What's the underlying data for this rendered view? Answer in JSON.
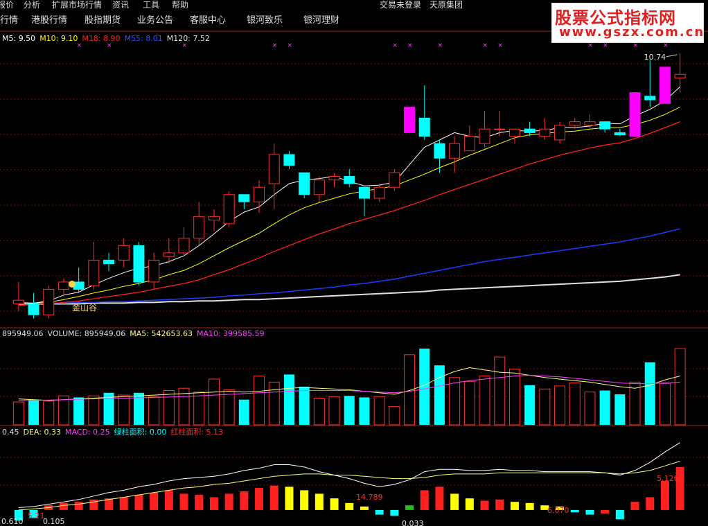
{
  "menu": {
    "items": [
      "报价",
      "分析",
      "扩展市场行情",
      "资讯",
      "工具",
      "帮助"
    ],
    "login_status": "交易未登录",
    "broker": "天原集团"
  },
  "tabs": [
    "行情",
    "港股行情",
    "股指期货",
    "业务公告",
    "客服中心",
    "银河致乐",
    "银河理财"
  ],
  "brand": {
    "title": "股票公式指标网",
    "url": "www.gszx.com.cn"
  },
  "colors": {
    "rise": "#ff3030",
    "fall": "#00ffff",
    "limit_up": "#ff00ff",
    "ma5": "#ffffff",
    "ma10": "#ffff00",
    "ma18": "#ff2020",
    "ma55": "#1e3cff",
    "ma120": "#e0e0e0",
    "vol_ma5": "#ffff80",
    "vol_ma10": "#ff40ff",
    "macd_pos": "#ff2020",
    "macd_neg": "#00ffff",
    "macd_yellow": "#ffff00",
    "macd_green": "#20c020"
  },
  "price_panel": {
    "legend": {
      "ma5": "M5: 9.50",
      "ma10": "M10: 9.10",
      "ma18": "M18: 8.90",
      "ma55": "M55: 8.01",
      "ma120": "M120: 7.52"
    },
    "high_label": "10.74",
    "annotation": "金山谷"
  },
  "volume_panel": {
    "legend": {
      "prefix": "895949.06",
      "volume": "VOLUME: 895949.06",
      "ma5": "MA5: 542653.63",
      "ma10": "MA10: 399585.59"
    }
  },
  "macd_panel": {
    "legend": {
      "prefix": "0.45",
      "dea": "DEA: 0.33",
      "macd": "MACD: 0.25",
      "green_area": "绿柱面积: 0.00",
      "red_area": "红柱面积: 5.13"
    },
    "labels": [
      "14.789",
      "6.070",
      "5.126",
      "0.610",
      "5.21",
      "0.105",
      "0.033"
    ]
  },
  "chart_data": {
    "type": "candlestick",
    "candles": [
      {
        "o": 7.3,
        "h": 7.6,
        "l": 7.2,
        "c": 7.35,
        "cls": "up"
      },
      {
        "o": 7.3,
        "h": 7.45,
        "l": 7.1,
        "c": 7.15,
        "cls": "down"
      },
      {
        "o": 7.15,
        "h": 7.55,
        "l": 7.1,
        "c": 7.5,
        "cls": "up"
      },
      {
        "o": 7.5,
        "h": 7.65,
        "l": 7.4,
        "c": 7.6,
        "cls": "up"
      },
      {
        "o": 7.6,
        "h": 7.8,
        "l": 7.45,
        "c": 7.5,
        "cls": "down"
      },
      {
        "o": 7.55,
        "h": 8.15,
        "l": 7.5,
        "c": 7.9,
        "cls": "up"
      },
      {
        "o": 7.85,
        "h": 8.0,
        "l": 7.75,
        "c": 7.9,
        "cls": "down"
      },
      {
        "o": 7.9,
        "h": 8.2,
        "l": 7.8,
        "c": 8.1,
        "cls": "up"
      },
      {
        "o": 8.1,
        "h": 8.15,
        "l": 7.55,
        "c": 7.6,
        "cls": "down"
      },
      {
        "o": 7.6,
        "h": 8.0,
        "l": 7.5,
        "c": 7.9,
        "cls": "up"
      },
      {
        "o": 7.95,
        "h": 8.2,
        "l": 7.85,
        "c": 8.0,
        "cls": "up"
      },
      {
        "o": 8.0,
        "h": 8.35,
        "l": 7.95,
        "c": 8.2,
        "cls": "up"
      },
      {
        "o": 8.2,
        "h": 8.7,
        "l": 8.1,
        "c": 8.5,
        "cls": "up"
      },
      {
        "o": 8.5,
        "h": 8.6,
        "l": 8.3,
        "c": 8.45,
        "cls": "up"
      },
      {
        "o": 8.4,
        "h": 8.85,
        "l": 8.35,
        "c": 8.8,
        "cls": "up"
      },
      {
        "o": 8.8,
        "h": 8.8,
        "l": 8.6,
        "c": 8.7,
        "cls": "down"
      },
      {
        "o": 8.7,
        "h": 9.0,
        "l": 8.55,
        "c": 8.9,
        "cls": "up"
      },
      {
        "o": 8.95,
        "h": 9.5,
        "l": 8.6,
        "c": 9.35,
        "cls": "up"
      },
      {
        "o": 9.35,
        "h": 9.4,
        "l": 9.15,
        "c": 9.2,
        "cls": "down"
      },
      {
        "o": 9.1,
        "h": 9.1,
        "l": 8.75,
        "c": 8.8,
        "cls": "down"
      },
      {
        "o": 8.8,
        "h": 9.05,
        "l": 8.7,
        "c": 9.0,
        "cls": "up"
      },
      {
        "o": 9.0,
        "h": 9.1,
        "l": 8.9,
        "c": 9.05,
        "cls": "up"
      },
      {
        "o": 9.05,
        "h": 9.15,
        "l": 8.9,
        "c": 8.95,
        "cls": "down"
      },
      {
        "o": 8.9,
        "h": 8.9,
        "l": 8.5,
        "c": 8.75,
        "cls": "down"
      },
      {
        "o": 8.75,
        "h": 8.95,
        "l": 8.7,
        "c": 8.9,
        "cls": "up"
      },
      {
        "o": 8.9,
        "h": 9.15,
        "l": 8.85,
        "c": 9.1,
        "cls": "up"
      },
      {
        "o": 9.65,
        "h": 10.0,
        "l": 9.65,
        "c": 10.0,
        "cls": "limit"
      },
      {
        "o": 9.85,
        "h": 10.3,
        "l": 9.55,
        "c": 9.6,
        "cls": "down"
      },
      {
        "o": 9.5,
        "h": 9.55,
        "l": 9.1,
        "c": 9.3,
        "cls": "down"
      },
      {
        "o": 9.3,
        "h": 9.6,
        "l": 9.1,
        "c": 9.5,
        "cls": "up"
      },
      {
        "o": 9.4,
        "h": 9.75,
        "l": 9.4,
        "c": 9.6,
        "cls": "up"
      },
      {
        "o": 9.5,
        "h": 9.95,
        "l": 9.45,
        "c": 9.7,
        "cls": "up"
      },
      {
        "o": 9.7,
        "h": 9.95,
        "l": 9.6,
        "c": 9.7,
        "cls": "up"
      },
      {
        "o": 9.6,
        "h": 9.7,
        "l": 9.5,
        "c": 9.7,
        "cls": "up"
      },
      {
        "o": 9.7,
        "h": 9.8,
        "l": 9.6,
        "c": 9.65,
        "cls": "down"
      },
      {
        "o": 9.6,
        "h": 9.85,
        "l": 9.55,
        "c": 9.7,
        "cls": "up"
      },
      {
        "o": 9.55,
        "h": 9.8,
        "l": 9.5,
        "c": 9.75,
        "cls": "up"
      },
      {
        "o": 9.75,
        "h": 9.85,
        "l": 9.7,
        "c": 9.8,
        "cls": "up"
      },
      {
        "o": 9.75,
        "h": 9.9,
        "l": 9.7,
        "c": 9.8,
        "cls": "up"
      },
      {
        "o": 9.8,
        "h": 9.8,
        "l": 9.65,
        "c": 9.7,
        "cls": "down"
      },
      {
        "o": 9.65,
        "h": 9.7,
        "l": 9.6,
        "c": 9.62,
        "cls": "down"
      },
      {
        "o": 9.6,
        "h": 10.2,
        "l": 9.6,
        "c": 10.2,
        "cls": "limit"
      },
      {
        "o": 10.1,
        "h": 10.65,
        "l": 10.0,
        "c": 10.15,
        "cls": "down"
      },
      {
        "o": 10.05,
        "h": 10.55,
        "l": 10.05,
        "c": 10.55,
        "cls": "limit"
      },
      {
        "o": 10.4,
        "h": 10.74,
        "l": 10.2,
        "c": 10.45,
        "cls": "up"
      }
    ],
    "ma5": [
      7.32,
      7.31,
      7.34,
      7.42,
      7.46,
      7.56,
      7.65,
      7.73,
      7.79,
      7.82,
      7.88,
      7.96,
      8.1,
      8.26,
      8.43,
      8.56,
      8.63,
      8.8,
      8.95,
      9.0,
      9.02,
      9.05,
      8.98,
      8.92,
      8.93,
      8.97,
      9.21,
      9.45,
      9.55,
      9.65,
      9.6,
      9.58,
      9.65,
      9.68,
      9.67,
      9.68,
      9.72,
      9.72,
      9.74,
      9.78,
      9.77,
      9.88,
      9.97,
      10.09,
      10.28
    ],
    "ma10": [
      7.3,
      7.31,
      7.32,
      7.36,
      7.4,
      7.45,
      7.49,
      7.54,
      7.58,
      7.63,
      7.7,
      7.76,
      7.85,
      7.96,
      8.07,
      8.17,
      8.27,
      8.4,
      8.52,
      8.62,
      8.69,
      8.75,
      8.81,
      8.85,
      8.88,
      8.92,
      9.0,
      9.08,
      9.17,
      9.25,
      9.34,
      9.42,
      9.5,
      9.58,
      9.62,
      9.64,
      9.66,
      9.67,
      9.7,
      9.72,
      9.72,
      9.76,
      9.82,
      9.9,
      10.0
    ],
    "ma18": [
      7.28,
      7.29,
      7.3,
      7.32,
      7.34,
      7.37,
      7.4,
      7.43,
      7.46,
      7.5,
      7.54,
      7.58,
      7.63,
      7.7,
      7.77,
      7.85,
      7.93,
      8.02,
      8.1,
      8.18,
      8.26,
      8.33,
      8.4,
      8.46,
      8.52,
      8.58,
      8.65,
      8.72,
      8.8,
      8.87,
      8.94,
      9.01,
      9.08,
      9.15,
      9.22,
      9.28,
      9.34,
      9.39,
      9.44,
      9.48,
      9.51,
      9.57,
      9.64,
      9.72,
      9.8
    ],
    "ma55": [
      7.3,
      7.3,
      7.31,
      7.31,
      7.32,
      7.32,
      7.33,
      7.33,
      7.34,
      7.35,
      7.36,
      7.37,
      7.38,
      7.39,
      7.41,
      7.42,
      7.44,
      7.45,
      7.47,
      7.49,
      7.51,
      7.53,
      7.56,
      7.58,
      7.61,
      7.64,
      7.68,
      7.72,
      7.76,
      7.8,
      7.84,
      7.88,
      7.91,
      7.94,
      7.97,
      8.0,
      8.03,
      8.06,
      8.09,
      8.12,
      8.15,
      8.19,
      8.23,
      8.28,
      8.33
    ],
    "ma120": [
      7.29,
      7.29,
      7.3,
      7.3,
      7.3,
      7.31,
      7.31,
      7.31,
      7.32,
      7.32,
      7.33,
      7.33,
      7.34,
      7.34,
      7.35,
      7.36,
      7.36,
      7.37,
      7.38,
      7.39,
      7.4,
      7.41,
      7.42,
      7.43,
      7.44,
      7.45,
      7.46,
      7.47,
      7.49,
      7.5,
      7.51,
      7.52,
      7.53,
      7.54,
      7.55,
      7.56,
      7.57,
      7.58,
      7.59,
      7.6,
      7.61,
      7.63,
      7.65,
      7.67,
      7.7
    ],
    "price_range": [
      7.0,
      10.9
    ],
    "volume": [
      300,
      330,
      310,
      380,
      360,
      380,
      420,
      390,
      420,
      370,
      450,
      480,
      430,
      600,
      460,
      330,
      640,
      560,
      660,
      500,
      350,
      370,
      380,
      360,
      370,
      240,
      920,
      1000,
      780,
      620,
      570,
      640,
      890,
      730,
      520,
      470,
      510,
      550,
      430,
      450,
      400,
      560,
      820,
      540,
      1000
    ],
    "volume_ma5": [
      340,
      330,
      320,
      330,
      340,
      350,
      360,
      370,
      380,
      390,
      400,
      410,
      420,
      430,
      440,
      430,
      440,
      460,
      480,
      490,
      480,
      470,
      460,
      440,
      420,
      400,
      450,
      520,
      620,
      700,
      750,
      720,
      690,
      680,
      650,
      620,
      600,
      580,
      560,
      530,
      500,
      480,
      520,
      590,
      640
    ],
    "volume_ma10": [
      320,
      320,
      325,
      330,
      335,
      340,
      345,
      350,
      355,
      360,
      365,
      370,
      380,
      390,
      400,
      410,
      420,
      430,
      440,
      450,
      450,
      450,
      450,
      440,
      430,
      420,
      440,
      470,
      510,
      550,
      580,
      600,
      620,
      640,
      650,
      640,
      630,
      610,
      590,
      570,
      550,
      540,
      540,
      550,
      560
    ],
    "volume_range": [
      0,
      1100
    ],
    "macd": [
      -0.09,
      -0.07,
      0.04,
      0.06,
      0.07,
      0.09,
      0.1,
      0.11,
      0.13,
      0.15,
      0.17,
      0.14,
      0.13,
      0.11,
      0.14,
      0.16,
      0.19,
      0.21,
      0.2,
      0.17,
      0.14,
      0.1,
      0.06,
      0.03,
      -0.04,
      -0.05,
      0.04,
      0.17,
      0.2,
      0.14,
      0.1,
      0.08,
      0.09,
      0.07,
      0.06,
      0.04,
      0.03,
      -0.02,
      -0.04,
      -0.03,
      -0.08,
      0.07,
      0.11,
      0.25,
      0.37
    ],
    "macd_color": [
      "neg",
      "neg",
      "pos",
      "pos",
      "pos",
      "pos",
      "pos",
      "pos",
      "pos",
      "pos",
      "pos",
      "pos",
      "pos",
      "pos",
      "pos",
      "pos",
      "pos",
      "pos",
      "yel",
      "yel",
      "yel",
      "yel",
      "yel",
      "yel",
      "neg",
      "neg",
      "grn",
      "pos",
      "pos",
      "yel",
      "yel",
      "pos",
      "pos",
      "yel",
      "yel",
      "yel",
      "yel",
      "neg",
      "neg",
      "pos",
      "neg",
      "pos",
      "pos",
      "pos",
      "pos"
    ],
    "dif": [
      0.02,
      0.03,
      0.05,
      0.07,
      0.09,
      0.12,
      0.15,
      0.17,
      0.2,
      0.22,
      0.25,
      0.27,
      0.28,
      0.29,
      0.31,
      0.34,
      0.36,
      0.39,
      0.39,
      0.37,
      0.33,
      0.3,
      0.27,
      0.23,
      0.2,
      0.22,
      0.26,
      0.33,
      0.35,
      0.35,
      0.34,
      0.34,
      0.35,
      0.34,
      0.34,
      0.33,
      0.33,
      0.33,
      0.33,
      0.32,
      0.3,
      0.34,
      0.41,
      0.5,
      0.58
    ],
    "dea": [
      0.0,
      0.01,
      0.02,
      0.04,
      0.05,
      0.07,
      0.09,
      0.11,
      0.13,
      0.15,
      0.17,
      0.19,
      0.2,
      0.22,
      0.23,
      0.25,
      0.27,
      0.29,
      0.3,
      0.31,
      0.31,
      0.3,
      0.3,
      0.29,
      0.28,
      0.27,
      0.27,
      0.28,
      0.3,
      0.31,
      0.31,
      0.31,
      0.32,
      0.32,
      0.32,
      0.32,
      0.32,
      0.32,
      0.32,
      0.32,
      0.31,
      0.32,
      0.34,
      0.38,
      0.42
    ],
    "macd_range": [
      -0.12,
      0.62
    ]
  }
}
